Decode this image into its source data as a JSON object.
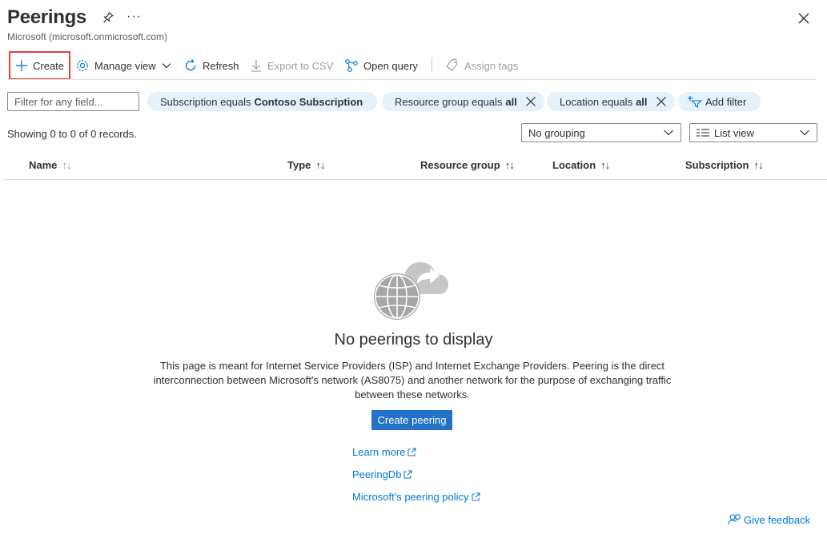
{
  "header": {
    "title": "Peerings",
    "subtitle": "Microsoft (microsoft.onmicrosoft.com)",
    "more_label": "···"
  },
  "toolbar": {
    "create": "Create",
    "manage_view": "Manage view",
    "refresh": "Refresh",
    "export": "Export to CSV",
    "open_query": "Open query",
    "assign_tags": "Assign tags"
  },
  "filters": {
    "search_placeholder": "Filter for any field...",
    "subscription": {
      "prefix": "Subscription equals",
      "value": "Contoso Subscription"
    },
    "resource_group": {
      "prefix": "Resource group equals",
      "value": "all"
    },
    "location": {
      "prefix": "Location equals",
      "value": "all"
    },
    "add_filter": "Add filter"
  },
  "records": {
    "summary": "Showing 0 to 0 of 0 records.",
    "grouping": "No grouping",
    "view": "List view"
  },
  "table": {
    "columns": [
      "Name",
      "Type",
      "Resource group",
      "Location",
      "Subscription"
    ]
  },
  "empty_state": {
    "title": "No peerings to display",
    "description": "This page is meant for Internet Service Providers (ISP) and Internet Exchange Providers. Peering is the direct interconnection between Microsoft's network (AS8075) and another network for the purpose of exchanging traffic between these networks.",
    "button": "Create peering",
    "links": [
      "Learn more",
      "PeeringDb",
      "Microsoft's peering policy"
    ]
  },
  "feedback": "Give feedback",
  "colors": {
    "accent": "#0078d4",
    "primary_button": "#2272c8",
    "highlight_border": "#e3403c",
    "pill_background": "#e6f2fb"
  },
  "icons": {
    "create": "plus-icon",
    "manage": "gear-icon",
    "refresh": "refresh-icon",
    "export": "download-icon",
    "query": "query-icon",
    "tags": "tag-icon",
    "pin": "pin-icon",
    "close": "close-icon",
    "empty": "globe-cloud-icon",
    "feedback": "feedback-icon"
  }
}
